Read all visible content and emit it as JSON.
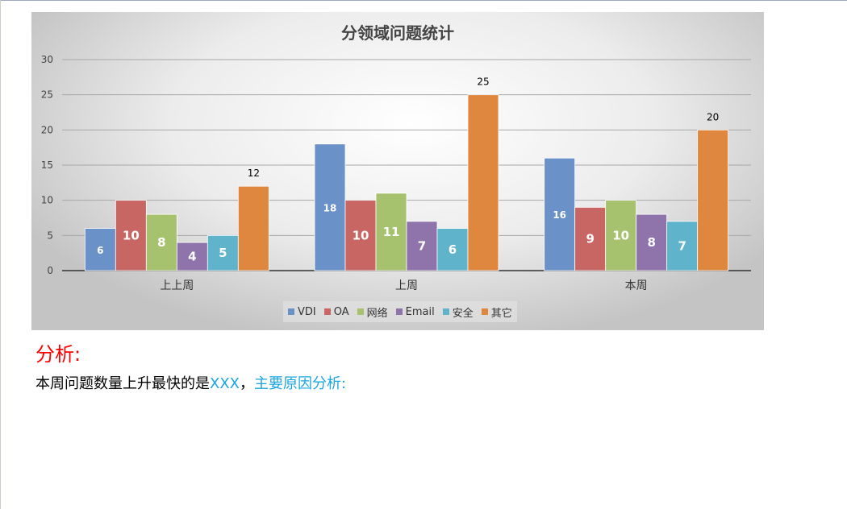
{
  "chart_data": {
    "type": "bar",
    "title": "分领域问题统计",
    "categories": [
      "上上周",
      "上周",
      "本周"
    ],
    "series": [
      {
        "name": "VDI",
        "color": "#6a92c8",
        "values": [
          6,
          18,
          16
        ]
      },
      {
        "name": "OA",
        "color": "#c86664",
        "values": [
          10,
          10,
          9
        ]
      },
      {
        "name": "网络",
        "color": "#a6c26e",
        "values": [
          8,
          11,
          10
        ]
      },
      {
        "name": "Email",
        "color": "#8e74ab",
        "values": [
          4,
          7,
          8
        ]
      },
      {
        "name": "安全",
        "color": "#5fb3cb",
        "values": [
          5,
          6,
          7
        ]
      },
      {
        "name": "其它",
        "color": "#e0873f",
        "values": [
          12,
          25,
          20
        ]
      }
    ],
    "ylim": [
      0,
      30
    ],
    "yticks": [
      0,
      5,
      10,
      15,
      20,
      25,
      30
    ],
    "grid": true,
    "legend_position": "bottom",
    "xlabel": "",
    "ylabel": ""
  },
  "analysis": {
    "heading": "分析:",
    "prefix": "本周问题数量上升最快的是",
    "highlight": "XXX",
    "separator": "，",
    "suffix": "主要原因分析:"
  }
}
